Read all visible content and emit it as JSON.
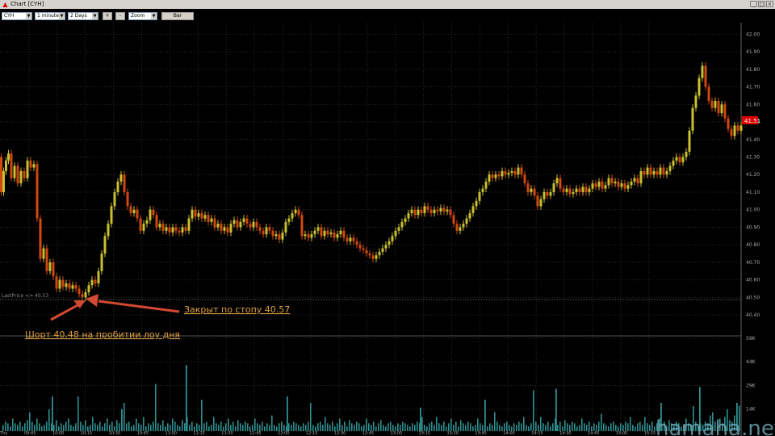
{
  "window": {
    "title": "Chart [CYH]"
  },
  "toolbar": {
    "symbol": "CYH",
    "interval": "1 minute",
    "period": "2 Days",
    "plus": "+",
    "minus": "-",
    "zoom": "Zoom",
    "bar": "Bar"
  },
  "annotations": {
    "stop_note": "Закрыт по стопу 40.57",
    "short_note": "Шорт 40.48 на пробитии лоу дня",
    "last_price": "LastPrice <= 40.53"
  },
  "watermark": "hamaha.net",
  "colors": {
    "up": "#c8c030",
    "down": "#d04810",
    "volume": "#2f8f8f",
    "last_badge": "#e00000",
    "arrow": "#d24a32",
    "annotation_text": "#e0a040"
  },
  "chart_data": {
    "type": "candlestick",
    "symbol": "CYH",
    "y_ticks": [
      "42.00",
      "41.90",
      "41.80",
      "41.70",
      "41.60",
      "41.50",
      "41.40",
      "41.30",
      "41.20",
      "41.10",
      "41.00",
      "40.90",
      "40.80",
      "40.70",
      "40.60",
      "40.50",
      "40.40"
    ],
    "ylim": [
      40.35,
      42.02
    ],
    "last_price": "41.51",
    "x_ticks": [
      "Thu",
      "09:45",
      "10:00",
      "10:15",
      "10:30",
      "10:45",
      "11:00",
      "11:15",
      "11:30",
      "11:45",
      "12:00",
      "12:15",
      "12:30",
      "12:45",
      "13:00",
      "13:15",
      "13:30",
      "13:45",
      "14:00",
      "14:15",
      "14:30",
      "14:45",
      "15:00",
      "15:15"
    ],
    "volume_ticks": [
      "59K",
      "44K",
      "29K",
      "14K"
    ],
    "volume_max": 59000,
    "price_path": [
      [
        0,
        41.3
      ],
      [
        3,
        41.1
      ],
      [
        6,
        41.22
      ],
      [
        9,
        41.28
      ],
      [
        12,
        41.32
      ],
      [
        16,
        41.18
      ],
      [
        20,
        41.25
      ],
      [
        24,
        41.15
      ],
      [
        28,
        41.22
      ],
      [
        32,
        41.18
      ],
      [
        36,
        41.28
      ],
      [
        40,
        41.24
      ],
      [
        44,
        41.26
      ],
      [
        48,
        40.95
      ],
      [
        52,
        40.72
      ],
      [
        56,
        40.78
      ],
      [
        60,
        40.65
      ],
      [
        64,
        40.7
      ],
      [
        68,
        40.62
      ],
      [
        72,
        40.55
      ],
      [
        76,
        40.6
      ],
      [
        80,
        40.56
      ],
      [
        84,
        40.58
      ],
      [
        88,
        40.55
      ],
      [
        92,
        40.57
      ],
      [
        96,
        40.55
      ],
      [
        100,
        40.52
      ],
      [
        104,
        40.5
      ],
      [
        108,
        40.53
      ],
      [
        112,
        40.57
      ],
      [
        116,
        40.6
      ],
      [
        120,
        40.58
      ],
      [
        124,
        40.65
      ],
      [
        128,
        40.75
      ],
      [
        132,
        40.85
      ],
      [
        136,
        40.92
      ],
      [
        140,
        41.02
      ],
      [
        144,
        41.1
      ],
      [
        148,
        41.16
      ],
      [
        152,
        41.2
      ],
      [
        156,
        41.1
      ],
      [
        160,
        41.02
      ],
      [
        164,
        40.98
      ],
      [
        168,
        41.0
      ],
      [
        172,
        40.95
      ],
      [
        176,
        40.88
      ],
      [
        180,
        40.92
      ],
      [
        184,
        40.94
      ],
      [
        188,
        41.0
      ],
      [
        192,
        40.97
      ],
      [
        196,
        40.9
      ],
      [
        200,
        40.92
      ],
      [
        204,
        40.88
      ],
      [
        208,
        40.9
      ],
      [
        212,
        40.87
      ],
      [
        216,
        40.9
      ],
      [
        220,
        40.88
      ],
      [
        224,
        40.87
      ],
      [
        228,
        40.9
      ],
      [
        232,
        40.88
      ],
      [
        236,
        40.95
      ],
      [
        240,
        41.0
      ],
      [
        244,
        40.96
      ],
      [
        248,
        40.98
      ],
      [
        252,
        40.95
      ],
      [
        256,
        40.97
      ],
      [
        260,
        40.93
      ],
      [
        264,
        40.95
      ],
      [
        268,
        40.9
      ],
      [
        272,
        40.92
      ],
      [
        276,
        40.88
      ],
      [
        280,
        40.9
      ],
      [
        284,
        40.87
      ],
      [
        288,
        40.92
      ],
      [
        292,
        40.94
      ],
      [
        296,
        40.9
      ],
      [
        300,
        40.93
      ],
      [
        304,
        40.95
      ],
      [
        308,
        40.92
      ],
      [
        312,
        40.9
      ],
      [
        316,
        40.93
      ],
      [
        320,
        40.9
      ],
      [
        324,
        40.88
      ],
      [
        328,
        40.86
      ],
      [
        332,
        40.9
      ],
      [
        336,
        40.88
      ],
      [
        340,
        40.85
      ],
      [
        344,
        40.86
      ],
      [
        348,
        40.83
      ],
      [
        352,
        40.87
      ],
      [
        356,
        40.93
      ],
      [
        360,
        40.95
      ],
      [
        364,
        40.98
      ],
      [
        368,
        41.0
      ],
      [
        372,
        40.97
      ],
      [
        376,
        40.85
      ],
      [
        380,
        40.86
      ],
      [
        384,
        40.84
      ],
      [
        388,
        40.86
      ],
      [
        392,
        40.88
      ],
      [
        396,
        40.9
      ],
      [
        400,
        40.85
      ],
      [
        404,
        40.88
      ],
      [
        408,
        40.86
      ],
      [
        412,
        40.87
      ],
      [
        416,
        40.84
      ],
      [
        420,
        40.86
      ],
      [
        424,
        40.88
      ],
      [
        428,
        40.84
      ],
      [
        432,
        40.82
      ],
      [
        436,
        40.84
      ],
      [
        440,
        40.82
      ],
      [
        444,
        40.8
      ],
      [
        448,
        40.78
      ],
      [
        452,
        40.77
      ],
      [
        456,
        40.75
      ],
      [
        460,
        40.74
      ],
      [
        464,
        40.72
      ],
      [
        468,
        40.74
      ],
      [
        472,
        40.76
      ],
      [
        476,
        40.78
      ],
      [
        480,
        40.8
      ],
      [
        484,
        40.82
      ],
      [
        488,
        40.85
      ],
      [
        492,
        40.88
      ],
      [
        496,
        40.9
      ],
      [
        500,
        40.93
      ],
      [
        504,
        40.95
      ],
      [
        508,
        40.98
      ],
      [
        512,
        41.0
      ],
      [
        516,
        40.97
      ],
      [
        520,
        41.0
      ],
      [
        524,
        40.98
      ],
      [
        528,
        41.02
      ],
      [
        532,
        41.0
      ],
      [
        536,
        40.98
      ],
      [
        540,
        41.0
      ],
      [
        544,
        40.99
      ],
      [
        548,
        41.01
      ],
      [
        552,
        40.99
      ],
      [
        556,
        41.0
      ],
      [
        560,
        40.97
      ],
      [
        564,
        40.92
      ],
      [
        568,
        40.88
      ],
      [
        572,
        40.9
      ],
      [
        576,
        40.92
      ],
      [
        580,
        40.95
      ],
      [
        584,
        40.98
      ],
      [
        588,
        41.02
      ],
      [
        592,
        41.05
      ],
      [
        596,
        41.1
      ],
      [
        600,
        41.12
      ],
      [
        604,
        41.16
      ],
      [
        608,
        41.2
      ],
      [
        612,
        41.18
      ],
      [
        616,
        41.2
      ],
      [
        620,
        41.19
      ],
      [
        624,
        41.22
      ],
      [
        628,
        41.2
      ],
      [
        632,
        41.21
      ],
      [
        636,
        41.22
      ],
      [
        640,
        41.2
      ],
      [
        644,
        41.24
      ],
      [
        648,
        41.2
      ],
      [
        652,
        41.15
      ],
      [
        656,
        41.1
      ],
      [
        660,
        41.12
      ],
      [
        664,
        41.08
      ],
      [
        668,
        41.02
      ],
      [
        672,
        41.06
      ],
      [
        676,
        41.1
      ],
      [
        680,
        41.08
      ],
      [
        684,
        41.1
      ],
      [
        688,
        41.15
      ],
      [
        692,
        41.18
      ],
      [
        696,
        41.12
      ],
      [
        700,
        41.1
      ],
      [
        704,
        41.12
      ],
      [
        708,
        41.09
      ],
      [
        712,
        41.1
      ],
      [
        716,
        41.12
      ],
      [
        720,
        41.1
      ],
      [
        724,
        41.13
      ],
      [
        728,
        41.1
      ],
      [
        732,
        41.12
      ],
      [
        736,
        41.15
      ],
      [
        740,
        41.13
      ],
      [
        744,
        41.16
      ],
      [
        748,
        41.12
      ],
      [
        752,
        41.14
      ],
      [
        756,
        41.18
      ],
      [
        760,
        41.15
      ],
      [
        764,
        41.16
      ],
      [
        768,
        41.13
      ],
      [
        772,
        41.15
      ],
      [
        776,
        41.12
      ],
      [
        780,
        41.14
      ],
      [
        784,
        41.16
      ],
      [
        788,
        41.18
      ],
      [
        792,
        41.15
      ],
      [
        796,
        41.22
      ],
      [
        800,
        41.2
      ],
      [
        804,
        41.24
      ],
      [
        808,
        41.2
      ],
      [
        812,
        41.22
      ],
      [
        816,
        41.2
      ],
      [
        820,
        41.24
      ],
      [
        824,
        41.2
      ],
      [
        828,
        41.22
      ],
      [
        832,
        41.25
      ],
      [
        836,
        41.28
      ],
      [
        840,
        41.3
      ],
      [
        844,
        41.27
      ],
      [
        848,
        41.3
      ],
      [
        852,
        41.33
      ],
      [
        856,
        41.45
      ],
      [
        860,
        41.58
      ],
      [
        864,
        41.65
      ],
      [
        868,
        41.75
      ],
      [
        872,
        41.82
      ],
      [
        876,
        41.7
      ],
      [
        880,
        41.62
      ],
      [
        884,
        41.58
      ],
      [
        888,
        41.62
      ],
      [
        892,
        41.55
      ],
      [
        896,
        41.6
      ],
      [
        900,
        41.52
      ],
      [
        904,
        41.46
      ],
      [
        908,
        41.42
      ],
      [
        912,
        41.48
      ],
      [
        916,
        41.45
      ],
      [
        920,
        41.48
      ]
    ],
    "volumes": [
      4,
      6,
      5,
      3,
      8,
      5,
      4,
      6,
      3,
      5,
      7,
      12,
      6,
      4,
      8,
      5,
      3,
      4,
      6,
      14,
      5,
      4,
      7,
      3,
      5,
      4,
      6,
      8,
      4,
      3,
      5,
      22,
      6,
      4,
      7,
      3,
      4,
      9,
      5,
      4,
      6,
      3,
      5,
      8,
      4,
      6,
      3,
      7,
      5,
      4,
      18,
      5,
      6,
      3,
      4,
      8,
      5,
      4,
      9,
      3,
      5,
      4,
      6,
      30,
      5,
      4,
      7,
      3,
      5,
      4,
      8,
      6,
      4,
      3,
      7,
      5,
      9,
      4,
      6,
      3,
      5,
      4,
      20,
      5,
      6,
      3,
      4,
      9,
      5,
      4,
      6,
      3,
      5,
      8,
      4,
      6,
      3,
      7,
      5,
      4,
      6,
      5,
      3,
      4,
      8,
      5,
      4,
      6,
      3,
      5,
      4,
      10,
      4,
      3,
      5,
      6,
      4,
      3,
      5,
      4,
      6,
      5,
      4,
      3,
      5,
      4,
      6,
      18,
      4,
      3,
      5,
      6,
      4,
      9,
      5,
      4,
      6,
      3,
      5,
      8,
      4,
      6,
      3,
      7,
      5,
      4,
      6,
      5,
      3,
      4,
      8,
      5,
      4,
      6,
      3,
      5,
      7,
      4,
      3,
      5,
      6,
      4,
      3,
      5,
      4,
      6,
      5,
      4,
      3,
      5,
      4,
      6,
      5,
      9,
      4,
      3,
      5,
      6,
      4,
      9,
      5,
      4,
      6,
      3,
      5,
      8,
      4,
      6,
      3,
      7,
      5,
      4,
      6,
      5,
      3,
      4,
      8,
      5,
      4,
      6,
      3,
      5,
      4,
      12,
      6,
      4,
      3,
      5,
      6,
      4,
      3,
      5,
      4,
      6,
      5,
      9,
      4,
      3,
      5,
      26,
      6,
      4,
      9,
      5,
      4,
      6,
      3,
      5,
      8,
      4,
      6,
      3,
      7,
      5,
      4,
      6,
      5,
      3,
      4,
      8,
      5,
      4,
      6,
      3,
      5,
      4,
      6,
      11,
      5,
      4,
      3,
      5,
      6,
      4,
      3,
      5,
      4,
      6,
      5,
      9,
      4,
      3,
      5,
      6,
      4,
      9,
      5,
      4,
      6,
      3,
      5,
      8,
      4,
      6,
      3,
      7,
      5,
      4,
      6,
      5,
      3,
      4,
      8,
      5,
      4,
      16,
      6,
      3,
      5,
      4,
      6,
      5,
      10,
      12,
      6,
      3,
      8,
      5,
      9,
      14,
      7,
      6,
      10,
      8,
      16,
      6,
      12,
      9,
      20,
      14,
      18,
      30,
      16,
      10,
      22,
      12,
      8,
      14,
      6,
      10,
      4
    ],
    "volume_spikes": [
      [
        64,
        22
      ],
      [
        150,
        14
      ],
      [
        230,
        42
      ],
      [
        355,
        22
      ],
      [
        520,
        15
      ],
      [
        600,
        20
      ],
      [
        688,
        27
      ],
      [
        818,
        18
      ],
      [
        866,
        28
      ],
      [
        912,
        18
      ]
    ]
  }
}
